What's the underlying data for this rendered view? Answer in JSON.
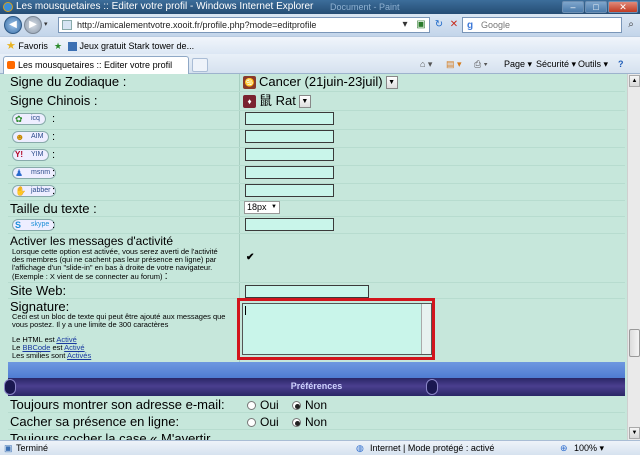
{
  "window": {
    "title": "Les mousquetaires :: Editer votre profil - Windows Internet Explorer",
    "ghost_title": "Document - Paint",
    "min": "–",
    "max": "□",
    "close": "✕"
  },
  "address": {
    "back": "◀",
    "forward": "▶",
    "url": "http://amicalementvotre.xooit.fr/profile.php?mode=editprofile",
    "search_placeholder": "Google",
    "search_btn": "⌕"
  },
  "favorites": {
    "label": "Favoris",
    "item": "Jeux gratuit Stark tower de..."
  },
  "tab": {
    "label": "Les mousquetaires :: Editer votre profil"
  },
  "commands": {
    "page": "Page ▾",
    "security": "Sécurité ▾",
    "tools": "Outils ▾",
    "help": "?"
  },
  "form": {
    "zodiac_label": "Signe du Zodiaque :",
    "zodiac_value": "Cancer (21juin-23juil)",
    "chinese_label": "Signe Chinois :",
    "chinese_glyph": "鼠",
    "chinese_value": "Rat",
    "im": [
      {
        "name": "icq",
        "icon": "✿",
        "color": "#2a8a2a"
      },
      {
        "name": "AIM",
        "icon": "☻",
        "color": "#c88a00"
      },
      {
        "name": "YIM",
        "icon": "Y!",
        "color": "#b00020"
      },
      {
        "name": "msnm",
        "icon": "♟",
        "color": "#2a6acd"
      },
      {
        "name": "jabber",
        "icon": "✋",
        "color": "#d4622a"
      }
    ],
    "colon": ":",
    "text_size_label": "Taille du texte :",
    "text_size_value": "18px",
    "skype": {
      "name": "skype",
      "icon": "S"
    },
    "activity_label": "Activer les messages d'activité",
    "activity_desc1": "Lorsque cette option est activée, vous serez averti de l'activité",
    "activity_desc2": "des membres (qui ne cachent pas leur présence en ligne) par",
    "activity_desc3": "l'affichage d'un \"slide-in\" en bas à droite de votre navigateur.",
    "activity_example": "(Exemple : X vient de se connecter au forum)",
    "activity_check": "✔",
    "website_label": "Site Web:",
    "signature_label": "Signature:",
    "sig_desc1": "Ceci est un bloc de texte qui peut être ajouté aux messages que",
    "sig_desc2": "vous postez. Il y a une limite de 300 caractères",
    "html_prefix": "Le HTML est",
    "html_state": "Activé",
    "bbcode_prefix": "Le",
    "bbcode_link": "BBCode",
    "bbcode_mid": "est",
    "bbcode_state": "Activé",
    "smilies_prefix": "Les smilies sont",
    "smilies_state": "Activés"
  },
  "preferences": {
    "title": "Préférences",
    "show_email": "Toujours montrer son adresse e-mail:",
    "hide_presence": "Cacher sa présence en ligne:",
    "notify": "Toujours cocher la case « M'avertir",
    "yes": "Oui",
    "no": "Non"
  },
  "statusbar": {
    "status": "Terminé",
    "zone": "Internet | Mode protégé : activé",
    "zoom": "100%"
  }
}
